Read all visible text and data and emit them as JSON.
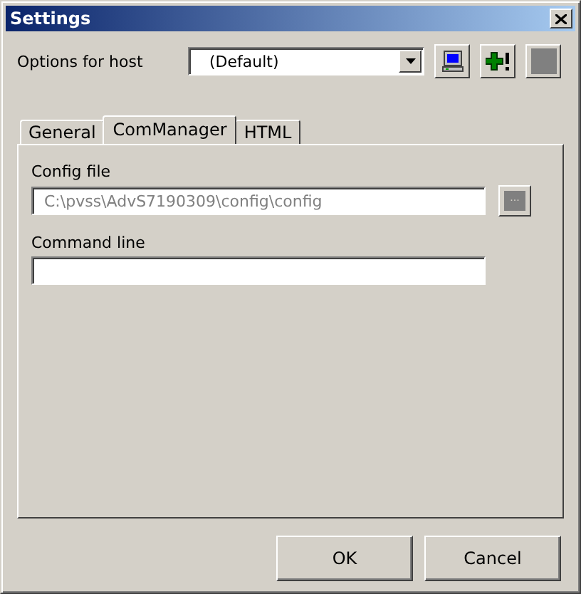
{
  "window": {
    "title": "Settings"
  },
  "host": {
    "label": "Options for host",
    "value": "(Default)",
    "tools": [
      {
        "kind": "computer"
      },
      {
        "kind": "add"
      },
      {
        "kind": "blank"
      }
    ]
  },
  "tabs": [
    {
      "label": "General",
      "selected": false
    },
    {
      "label": "ComManager",
      "selected": true
    },
    {
      "label": "HTML",
      "selected": false
    }
  ],
  "config_file": {
    "label": "Config file",
    "value": "C:\\pvss\\AdvS7190309\\config\\config",
    "disabled": true,
    "browse": {
      "label": "...",
      "disabled": true
    }
  },
  "command_line": {
    "label": "Command line"
  },
  "buttons": [
    "OK",
    "Cancel"
  ]
}
